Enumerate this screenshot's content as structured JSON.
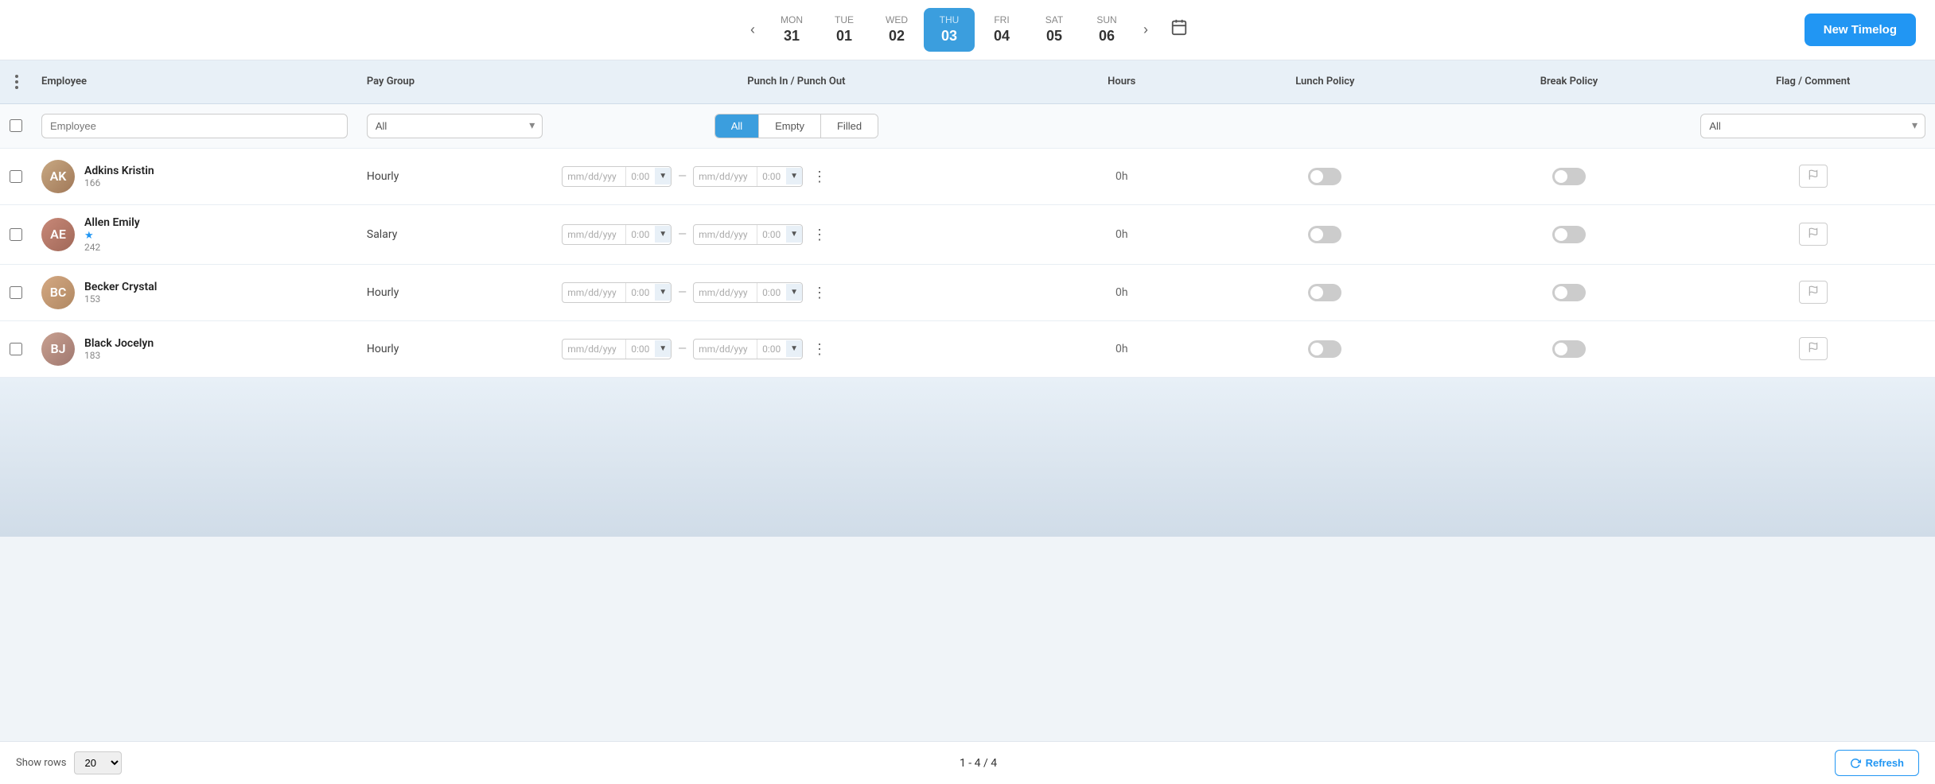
{
  "topbar": {
    "new_timelog_label": "New Timelog",
    "days": [
      {
        "name": "MON",
        "num": "31",
        "active": false
      },
      {
        "name": "TUE",
        "num": "01",
        "active": false
      },
      {
        "name": "WED",
        "num": "02",
        "active": false
      },
      {
        "name": "THU",
        "num": "03",
        "active": true
      },
      {
        "name": "FRI",
        "num": "04",
        "active": false
      },
      {
        "name": "SAT",
        "num": "05",
        "active": false
      },
      {
        "name": "SUN",
        "num": "06",
        "active": false
      }
    ]
  },
  "table": {
    "columns": [
      "Employee",
      "Pay Group",
      "Punch In / Punch Out",
      "Hours",
      "Lunch Policy",
      "Break Policy",
      "Flag / Comment"
    ],
    "filters": {
      "employee_placeholder": "Employee",
      "paygroup_placeholder": "All",
      "all_label": "All",
      "empty_label": "Empty",
      "filled_label": "Filled",
      "flag_placeholder": "All"
    },
    "rows": [
      {
        "id": "adkins-kristin",
        "name": "Adkins Kristin",
        "emp_num": "166",
        "pay_group": "Hourly",
        "hours": "0h",
        "has_star": false,
        "avatar_initials": "AK",
        "avatar_class": "av-kristin"
      },
      {
        "id": "allen-emily",
        "name": "Allen Emily",
        "emp_num": "242",
        "pay_group": "Salary",
        "hours": "0h",
        "has_star": true,
        "avatar_initials": "AE",
        "avatar_class": "av-emily"
      },
      {
        "id": "becker-crystal",
        "name": "Becker Crystal",
        "emp_num": "153",
        "pay_group": "Hourly",
        "hours": "0h",
        "has_star": false,
        "avatar_initials": "BC",
        "avatar_class": "av-crystal"
      },
      {
        "id": "black-jocelyn",
        "name": "Black Jocelyn",
        "emp_num": "183",
        "pay_group": "Hourly",
        "hours": "0h",
        "has_star": false,
        "avatar_initials": "BJ",
        "avatar_class": "av-jocelyn"
      }
    ],
    "punch_placeholder_date": "mm/dd/yyy",
    "punch_placeholder_time": "0:00"
  },
  "footer": {
    "show_rows_label": "Show rows",
    "rows_value": "20",
    "page_info": "1 - 4 / 4",
    "refresh_label": "Refresh"
  }
}
